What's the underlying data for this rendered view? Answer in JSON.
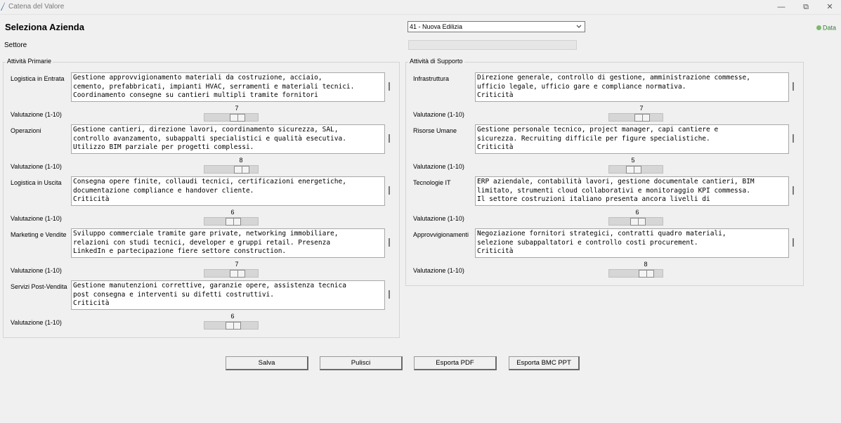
{
  "window": {
    "title": "Catena del Valore",
    "minimize_glyph": "—",
    "maximize_glyph": "⧉",
    "close_glyph": "✕"
  },
  "header": {
    "title": "Seleziona Azienda",
    "company_select": "41 - Nuova Edilizia",
    "sector_label": "Settore",
    "sector_value": "",
    "data_indicator": "Data",
    "data_indicator_color": "#7aba6e"
  },
  "primary": {
    "title": "Attività Primarie",
    "rows": [
      {
        "label": "Logistica in Entrata",
        "text": "Gestione approvvigionamento materiali da costruzione, acciaio,\ncemento, prefabbricati, impianti HVAC, serramenti e materiali tecnici.\nCoordinamento consegne su cantieri multipli tramite fornitori",
        "rating_label": "Valutazione (1-10)",
        "rating": "7",
        "rating_value": 7
      },
      {
        "label": "Operazioni",
        "text": "Gestione cantieri, direzione lavori, coordinamento sicurezza, SAL,\ncontrollo avanzamento, subappalti specialistici e qualità esecutiva.\nUtilizzo BIM parziale per progetti complessi.",
        "rating_label": "Valutazione (1-10)",
        "rating": "8",
        "rating_value": 8
      },
      {
        "label": "Logistica in Uscita",
        "text": "Consegna opere finite, collaudi tecnici, certificazioni energetiche,\ndocumentazione compliance e handover cliente.\nCriticità",
        "rating_label": "Valutazione (1-10)",
        "rating": "6",
        "rating_value": 6
      },
      {
        "label": "Marketing e Vendite",
        "text": "Sviluppo commerciale tramite gare private, networking immobiliare,\nrelazioni con studi tecnici, developer e gruppi retail. Presenza\nLinkedIn e partecipazione fiere settore construction.",
        "rating_label": "Valutazione (1-10)",
        "rating": "7",
        "rating_value": 7
      },
      {
        "label": "Servizi Post-Vendita",
        "text": "Gestione manutenzioni correttive, garanzie opere, assistenza tecnica\npost consegna e interventi su difetti costruttivi.\nCriticità",
        "rating_label": "Valutazione (1-10)",
        "rating": "6",
        "rating_value": 6
      }
    ]
  },
  "support": {
    "title": "Attività di Supporto",
    "rows": [
      {
        "label": "Infrastruttura",
        "text": "Direzione generale, controllo di gestione, amministrazione commesse,\nufficio legale, ufficio gare e compliance normativa.\nCriticità",
        "rating_label": "Valutazione (1-10)",
        "rating": "7",
        "rating_value": 7
      },
      {
        "label": "Risorse Umane",
        "text": "Gestione personale tecnico, project manager, capi cantiere e\nsicurezza. Recruiting difficile per figure specialistiche.\nCriticità",
        "rating_label": "Valutazione (1-10)",
        "rating": "5",
        "rating_value": 5
      },
      {
        "label": "Tecnologie IT",
        "text": "ERP aziendale, contabilità lavori, gestione documentale cantieri, BIM\nlimitato, strumenti cloud collaborativi e monitoraggio KPI commessa.\nIl settore costruzioni italiano presenta ancora livelli di",
        "rating_label": "Valutazione (1-10)",
        "rating": "6",
        "rating_value": 6
      },
      {
        "label": "Approvvigionamenti",
        "text": "Negoziazione fornitori strategici, contratti quadro materiali,\nselezione subappaltatori e controllo costi procurement.\nCriticità",
        "rating_label": "Valutazione (1-10)",
        "rating": "8",
        "rating_value": 8
      }
    ]
  },
  "buttons": {
    "save": "Salva",
    "clear": "Pulisci",
    "export_pdf": "Esporta PDF",
    "export_bmc": "Esporta BMC PPT"
  }
}
